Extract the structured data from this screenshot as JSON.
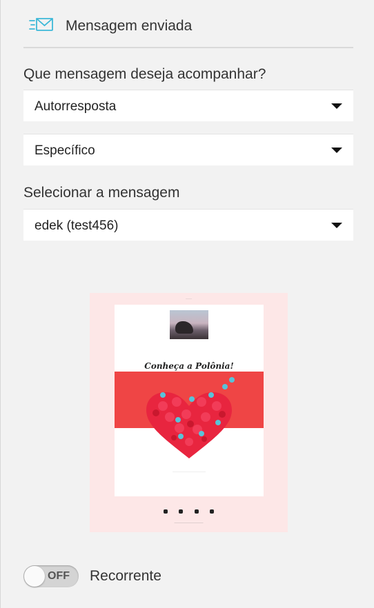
{
  "header": {
    "title": "Mensagem enviada",
    "icon": "envelope-sent-icon",
    "accent": "#3cb8d8"
  },
  "follow_question": {
    "label": "Que mensagem deseja acompanhar?"
  },
  "selects": {
    "message_type": {
      "value": "Autorresposta"
    },
    "scope": {
      "value": "Específico"
    }
  },
  "select_message": {
    "label": "Selecionar a mensagem",
    "value": "edek (test456)"
  },
  "preview": {
    "headline": "Conheça a Polônia!",
    "background": "#fde7e7",
    "band_color": "#ef4545"
  },
  "recurring": {
    "state_label": "OFF",
    "label": "Recorrente",
    "enabled": false
  }
}
